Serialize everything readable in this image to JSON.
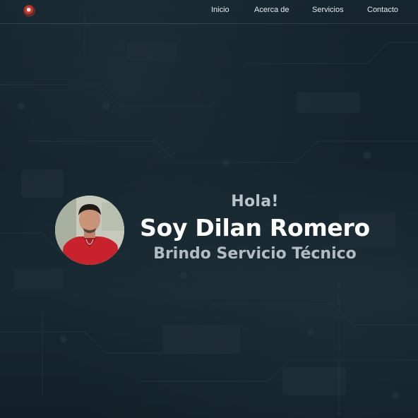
{
  "nav": {
    "items": [
      {
        "label": "Inicio"
      },
      {
        "label": "Acerca de"
      },
      {
        "label": "Servicios"
      },
      {
        "label": "Contacto"
      }
    ]
  },
  "hero": {
    "greeting": "Hola!",
    "name": "Soy Dilan Romero",
    "tagline": "Brindo Servicio Técnico"
  },
  "colors": {
    "background": "#16242c",
    "accent_text": "#ffffff",
    "muted_text": "#b9c3c8"
  }
}
